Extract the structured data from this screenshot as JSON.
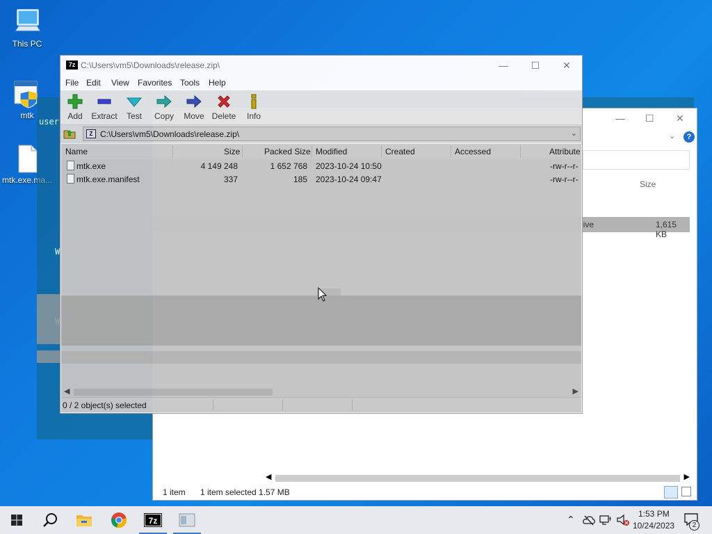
{
  "desktop": {
    "icons": [
      {
        "label": "This PC"
      },
      {
        "label": "mtk"
      },
      {
        "label": "mtk.exe.ma..."
      }
    ]
  },
  "terminal_ghost": {
    "line1": "username: vm5",
    "line2": "W",
    "line3": "W"
  },
  "explorer": {
    "size_header": "Size",
    "row_type": "hive",
    "row_size": "1,615 KB",
    "status_items": "1 item",
    "status_selected": "1 item selected  1.57 MB"
  },
  "sevenzip": {
    "app_icon": "7z",
    "title": "C:\\Users\\vm5\\Downloads\\release.zip\\",
    "menu": [
      "File",
      "Edit",
      "View",
      "Favorites",
      "Tools",
      "Help"
    ],
    "toolbar": [
      {
        "label": "Add",
        "icon": "plus-icon",
        "color": "#2ea62e"
      },
      {
        "label": "Extract",
        "icon": "minus-icon",
        "color": "#3b3fd8"
      },
      {
        "label": "Test",
        "icon": "check-icon",
        "color": "#23b9c8"
      },
      {
        "label": "Copy",
        "icon": "copy-arrow-icon",
        "color": "#2aa7a0"
      },
      {
        "label": "Move",
        "icon": "move-arrow-icon",
        "color": "#3a4fb8"
      },
      {
        "label": "Delete",
        "icon": "delete-x-icon",
        "color": "#d22c2c"
      },
      {
        "label": "Info",
        "icon": "info-icon",
        "color": "#c9a800"
      }
    ],
    "address": "C:\\Users\\vm5\\Downloads\\release.zip\\",
    "columns": [
      "Name",
      "Size",
      "Packed Size",
      "Modified",
      "Created",
      "Accessed",
      "Attribute"
    ],
    "files": [
      {
        "name": "mtk.exe",
        "size": "4 149 248",
        "packed": "1 652 768",
        "modified": "2023-10-24 10:50",
        "attr": "-rw-r--r-"
      },
      {
        "name": "mtk.exe.manifest",
        "size": "337",
        "packed": "185",
        "modified": "2023-10-24 09:47",
        "attr": "-rw-r--r-"
      }
    ],
    "status": "0 / 2 object(s) selected"
  },
  "taskbar": {
    "time": "1:53 PM",
    "date": "10/24/2023",
    "notifications": "2",
    "pinned": [
      "start-icon",
      "search-icon",
      "file-explorer-icon",
      "chrome-icon",
      "7zip-icon",
      "app-window-icon"
    ]
  }
}
